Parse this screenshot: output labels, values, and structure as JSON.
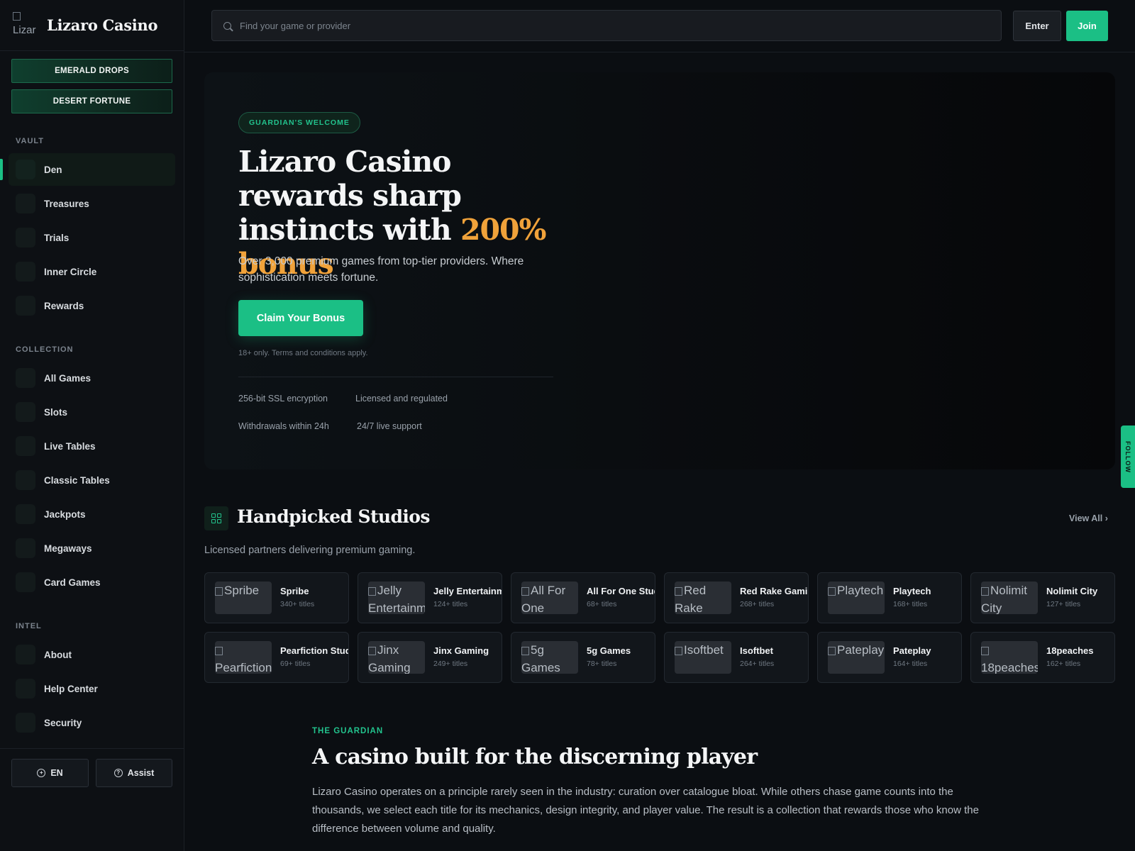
{
  "brand": {
    "name": "Lizaro Casino",
    "logo_alt": "Lizar"
  },
  "promos": [
    "EMERALD DROPS",
    "DESERT FORTUNE"
  ],
  "sidebar": {
    "vault_title": "VAULT",
    "vault_items": [
      "Den",
      "Treasures",
      "Trials",
      "Inner Circle",
      "Rewards"
    ],
    "collection_title": "COLLECTION",
    "collection_items": [
      "All Games",
      "Slots",
      "Live Tables",
      "Classic Tables",
      "Jackpots",
      "Megaways",
      "Card Games"
    ],
    "intel_title": "INTEL",
    "intel_items": [
      "About",
      "Help Center",
      "Security"
    ],
    "language": "EN",
    "assist": "Assist"
  },
  "header": {
    "search_placeholder": "Find your game or provider",
    "enter_label": "Enter",
    "join_label": "Join"
  },
  "hero": {
    "badge": "GUARDIAN'S WELCOME",
    "title": "Lizaro Casino rewards sharp instincts with",
    "highlight": "200% bonus",
    "subtitle": "Over 3,000 premium games from top-tier providers. Where sophistication meets fortune.",
    "cta": "Claim Your Bonus",
    "terms": "18+ only. Terms and conditions apply.",
    "trust": [
      "256-bit SSL encryption",
      "Licensed and regulated",
      "Withdrawals within 24h",
      "24/7 live support"
    ],
    "side_tab": "FOLLOW"
  },
  "studios": {
    "title": "Handpicked Studios",
    "view_all": "View All",
    "subtitle": "Licensed partners delivering premium gaming.",
    "items": [
      {
        "img": "Spribe",
        "name": "Spribe",
        "count": "340+ titles"
      },
      {
        "img": "Jelly Entertainm",
        "name": "Jelly Entertainment",
        "count": "124+ titles"
      },
      {
        "img": "All For One",
        "name": "All For One Studios",
        "count": "68+ titles"
      },
      {
        "img": "Red Rake",
        "name": "Red Rake Gaming",
        "count": "268+ titles"
      },
      {
        "img": "Playtech",
        "name": "Playtech",
        "count": "168+ titles"
      },
      {
        "img": "Nolimit City",
        "name": "Nolimit City",
        "count": "127+ titles"
      },
      {
        "img": "Pearfiction",
        "name": "Pearfiction Studios",
        "count": "69+ titles"
      },
      {
        "img": "Jinx Gaming",
        "name": "Jinx Gaming",
        "count": "249+ titles"
      },
      {
        "img": "5g Games",
        "name": "5g Games",
        "count": "78+ titles"
      },
      {
        "img": "Isoftbet",
        "name": "Isoftbet",
        "count": "264+ titles"
      },
      {
        "img": "Pateplay",
        "name": "Pateplay",
        "count": "164+ titles"
      },
      {
        "img": "18peaches",
        "name": "18peaches",
        "count": "162+ titles"
      }
    ]
  },
  "about": {
    "eyebrow": "THE GUARDIAN",
    "title": "A casino built for the discerning player",
    "text": "Lizaro Casino operates on a principle rarely seen in the industry: curation over catalogue bloat. While others chase game counts into the thousands, we select each title for its mechanics, design integrity, and player value. The result is a collection that rewards those who know the difference between volume and quality."
  },
  "colors": {
    "accent": "#1bbf85",
    "highlight": "#f0a23a",
    "background": "#0b0e12"
  }
}
